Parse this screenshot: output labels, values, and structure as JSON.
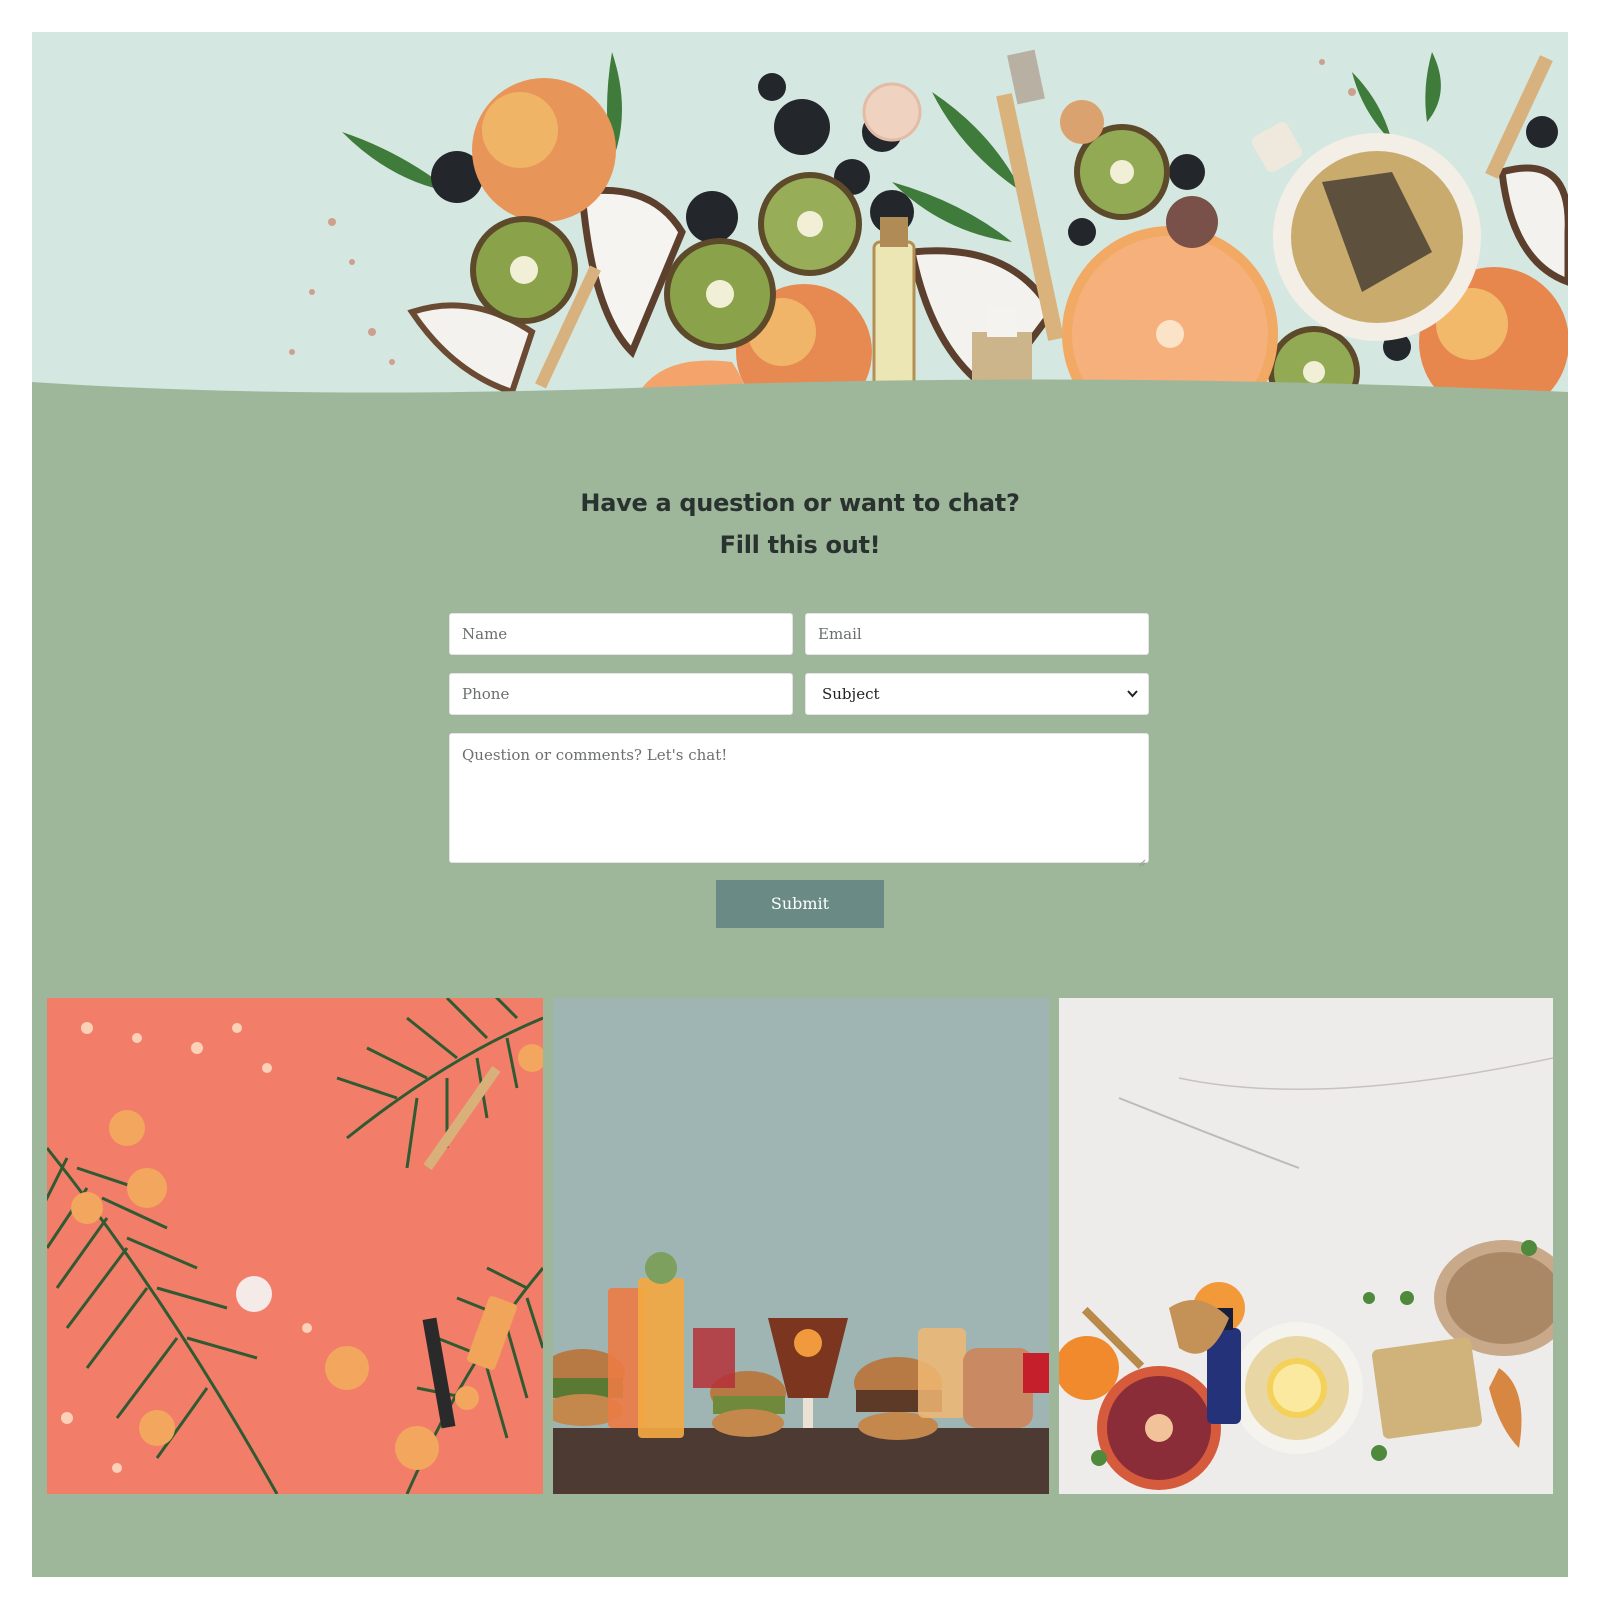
{
  "form": {
    "heading_line1": "Have a question or want to chat?",
    "heading_line2": "Fill this out!",
    "name_placeholder": "Name",
    "email_placeholder": "Email",
    "phone_placeholder": "Phone",
    "subject_selected": "Subject",
    "comments_placeholder": "Question or comments? Let's chat!",
    "submit_label": "Submit"
  },
  "colors": {
    "page_background": "#ffffff",
    "section_background": "#9eb79a",
    "submit_background": "#6a8a86",
    "heading_text": "#2a3230"
  },
  "images": {
    "hero": "flat-lay-fruits-kiwi-apples-citrus-tea-cosmetics-image",
    "gallery": [
      "coral-background-palm-leaves-flowers-cosmetics-image",
      "burgers-and-cocktails-on-table-image",
      "marble-tea-citrus-ginger-honey-image"
    ]
  }
}
